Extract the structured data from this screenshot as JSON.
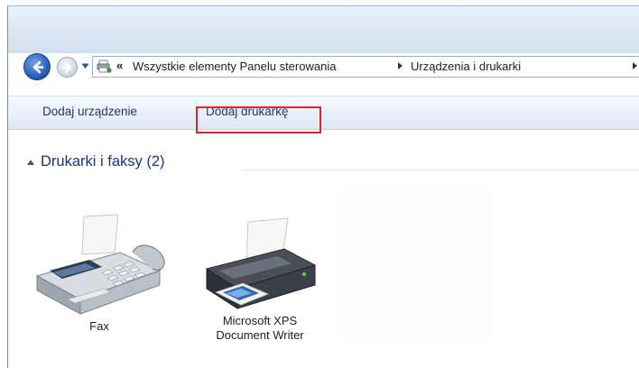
{
  "navigation": {
    "back_icon": "back-arrow-icon",
    "forward_icon": "forward-arrow-icon",
    "history_icon": "chevron-down-icon",
    "location_icon": "devices-printers-icon"
  },
  "address_bar": {
    "overflow": "«",
    "crumbs": [
      "Wszystkie elementy Panelu sterowania",
      "Urządzenia i drukarki"
    ]
  },
  "toolbar": {
    "add_device": "Dodaj urządzenie",
    "add_printer": "Dodaj drukarkę"
  },
  "group": {
    "title": "Drukarki i faksy (2)"
  },
  "devices": [
    {
      "label_line1": "Fax",
      "label_line2": "",
      "icon": "fax-icon"
    },
    {
      "label_line1": "Microsoft XPS",
      "label_line2": "Document Writer",
      "icon": "printer-icon"
    }
  ],
  "colors": {
    "highlight": "#e0222a",
    "group_title": "#1e3287",
    "toolbar_text": "#1e3a66"
  }
}
